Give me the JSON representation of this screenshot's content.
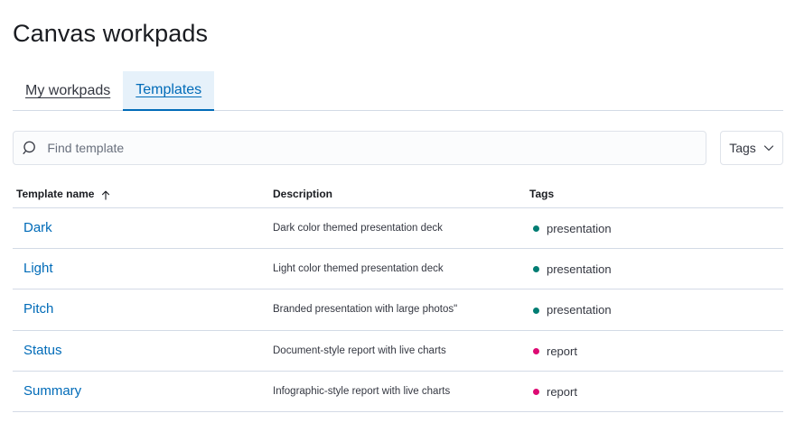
{
  "page": {
    "title": "Canvas workpads"
  },
  "tabs": [
    {
      "label": "My workpads",
      "selected": false
    },
    {
      "label": "Templates",
      "selected": true
    }
  ],
  "search": {
    "placeholder": "Find template",
    "value": ""
  },
  "filter": {
    "label": "Tags"
  },
  "table": {
    "headers": {
      "name": "Template name",
      "description": "Description",
      "tags": "Tags"
    },
    "sort": "ascending",
    "rows": [
      {
        "name": "Dark",
        "description": "Dark color themed presentation deck",
        "tag": "presentation",
        "tag_color": "#017d73"
      },
      {
        "name": "Light",
        "description": "Light color themed presentation deck",
        "tag": "presentation",
        "tag_color": "#017d73"
      },
      {
        "name": "Pitch",
        "description": "Branded presentation with large photos\"",
        "tag": "presentation",
        "tag_color": "#017d73"
      },
      {
        "name": "Status",
        "description": "Document-style report with live charts",
        "tag": "report",
        "tag_color": "#dd0a73"
      },
      {
        "name": "Summary",
        "description": "Infographic-style report with live charts",
        "tag": "report",
        "tag_color": "#dd0a73"
      }
    ]
  },
  "colors": {
    "link": "#006bb8",
    "presentation": "#017d73",
    "report": "#dd0a73"
  }
}
